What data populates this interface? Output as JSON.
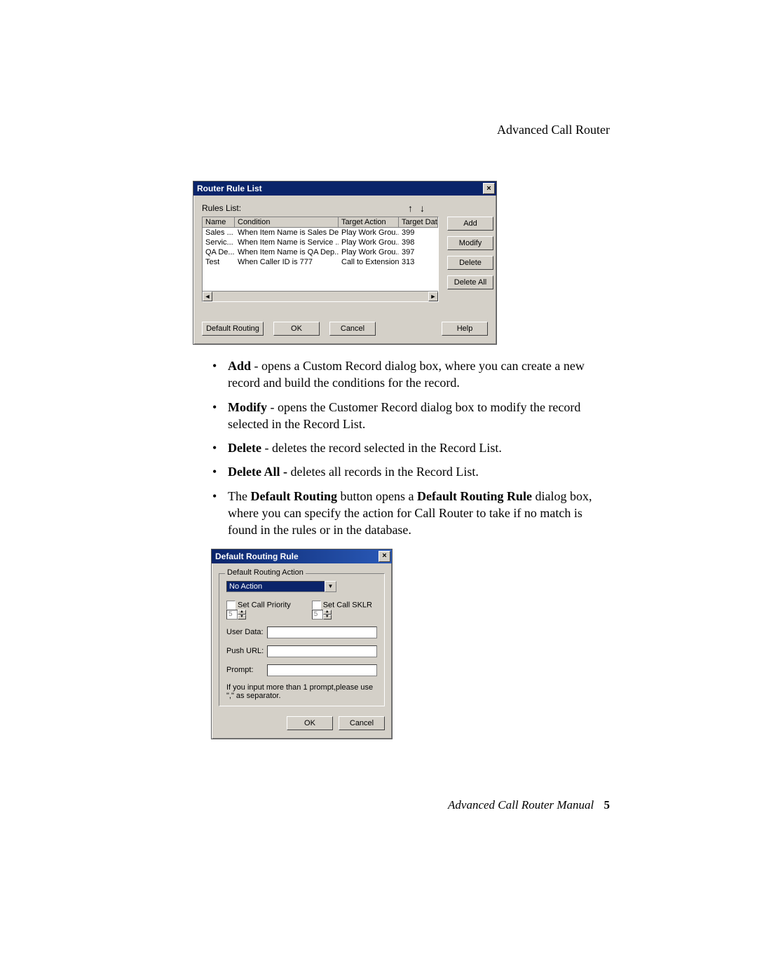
{
  "page": {
    "running_head": "Advanced Call Router",
    "footer": "Advanced Call Router Manual",
    "page_number": "5"
  },
  "router_dialog": {
    "title": "Router Rule List",
    "close": "×",
    "rules_label": "Rules List:",
    "arrow_up": "↑",
    "arrow_down": "↓",
    "cols": {
      "name": "Name",
      "condition": "Condition",
      "target_action": "Target Action",
      "target_data": "Target Data"
    },
    "rows": [
      {
        "name": "Sales ...",
        "condition": "When Item Name is Sales De...",
        "target_action": "Play Work Grou...",
        "target_data": "399"
      },
      {
        "name": "Servic...",
        "condition": "When Item Name is Service ...",
        "target_action": "Play Work Grou...",
        "target_data": "398"
      },
      {
        "name": "QA De...",
        "condition": "When Item Name is QA Dep...",
        "target_action": "Play Work Grou...",
        "target_data": "397"
      },
      {
        "name": "Test",
        "condition": "When Caller ID is 777",
        "target_action": "Call to Extension...",
        "target_data": "313"
      }
    ],
    "scroll_left": "◄",
    "scroll_right": "►",
    "buttons": {
      "add": "Add",
      "modify": "Modify",
      "delete": "Delete",
      "delete_all": "Delete All",
      "default_routing": "Default Routing",
      "ok": "OK",
      "cancel": "Cancel",
      "help": "Help"
    }
  },
  "bullets": {
    "b1": {
      "strong": "Add",
      "rest": " - opens a Custom Record dialog box, where you can create a new record and build the conditions for the record."
    },
    "b2": {
      "strong": "Modify",
      "rest": " - opens the Customer Record dialog box to modify the record selected in the Record List."
    },
    "b3": {
      "strong": "Delete",
      "rest": " - deletes the record selected in the Record List."
    },
    "b4": {
      "strong": "Delete All - ",
      "rest": "deletes all records in the Record List."
    },
    "b5": {
      "pre": "The ",
      "s1": "Default Routing",
      "mid": " button opens a ",
      "s2": "Default Routing Rule",
      "rest": " dialog box, where you can specify the action for Call Router to take if no match is found in the rules or in the database."
    }
  },
  "drr_dialog": {
    "title": "Default Routing Rule",
    "close": "×",
    "group_title": "Default Routing Action",
    "combo_value": "No Action",
    "combo_arrow": "▼",
    "chk_priority": "Set Call Priority",
    "chk_sklr": "Set Call SKLR",
    "spin_val": "5",
    "user_data": "User Data:",
    "push_url": "Push URL:",
    "prompt": "Prompt:",
    "hint": "If you input more than 1 prompt,please use \",\" as separator.",
    "ok": "OK",
    "cancel": "Cancel"
  }
}
